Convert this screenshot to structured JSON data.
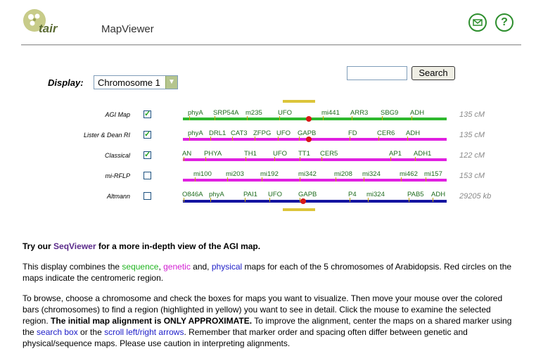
{
  "header": {
    "logo_text": "tair",
    "title": "MapViewer",
    "mail_icon": "mail-icon",
    "help_glyph": "?"
  },
  "controls": {
    "display_label": "Display:",
    "chromosome_selected": "Chromosome 1",
    "search_value": "",
    "search_button": "Search"
  },
  "maps": [
    {
      "name": "AGI Map",
      "checked": true,
      "units": "135 cM",
      "color": "#2eb82e",
      "markers": [
        "phyA",
        "SRP54A",
        "m235",
        "UFO",
        "mi441",
        "ARR3",
        "SBG9",
        "ADH"
      ]
    },
    {
      "name": "Lister & Dean RI",
      "checked": true,
      "units": "135 cM",
      "color": "#e020e0",
      "markers": [
        "phyA",
        "DRL1",
        "CAT3",
        "ZFPG",
        "UFO",
        "GAPB",
        "FD",
        "CER6",
        "ADH"
      ]
    },
    {
      "name": "Classical",
      "checked": true,
      "units": "122 cM",
      "color": "#e020e0",
      "markers": [
        "AN",
        "PHYA",
        "TH1",
        "UFO",
        "TT1",
        "CER5",
        "AP1",
        "ADH1"
      ]
    },
    {
      "name": "mi-RFLP",
      "checked": false,
      "units": "153 cM",
      "color": "#e020e0",
      "markers": [
        "mi100",
        "mi203",
        "mi192",
        "mi342",
        "mi208",
        "mi324",
        "mi462",
        "mi157"
      ]
    },
    {
      "name": "Altmann",
      "checked": false,
      "units": "29205 kb",
      "color": "#1414a0",
      "markers": [
        "O846A",
        "phyA",
        "PAI1",
        "UFO",
        "GAPB",
        "P4",
        "mi324",
        "PAB5",
        "ADH"
      ]
    }
  ],
  "text": {
    "try_prefix": "Try our ",
    "try_link": "SeqViewer",
    "try_suffix": " for a more in-depth view of the AGI map.",
    "p1_a": "This display combines the ",
    "p1_seq": "sequence",
    "p1_b": ", ",
    "p1_gen": "genetic",
    "p1_c": " and, ",
    "p1_phys": "physical",
    "p1_d": " maps for each of the 5 chromosomes of Arabidopsis. Red circles on the maps indicate the centromeric region.",
    "p2_a": "To browse, choose a chromosome and check the boxes for maps you want to visualize. Then move your mouse over the colored bars (chromosomes) to find a region (highlighted in yellow) you want to see in detail. Click the mouse to examine the selected region. ",
    "p2_bold": "The initial map alignment is ONLY APPROXIMATE.",
    "p2_b": " To improve the alignment, center the maps on a shared marker using the ",
    "p2_link1": "search box",
    "p2_c": " or the ",
    "p2_link2": "scroll left/right arrows",
    "p2_d": ". Remember that marker order and spacing often differ between genetic and physical/sequence maps. Please use caution in interpreting alignments."
  }
}
